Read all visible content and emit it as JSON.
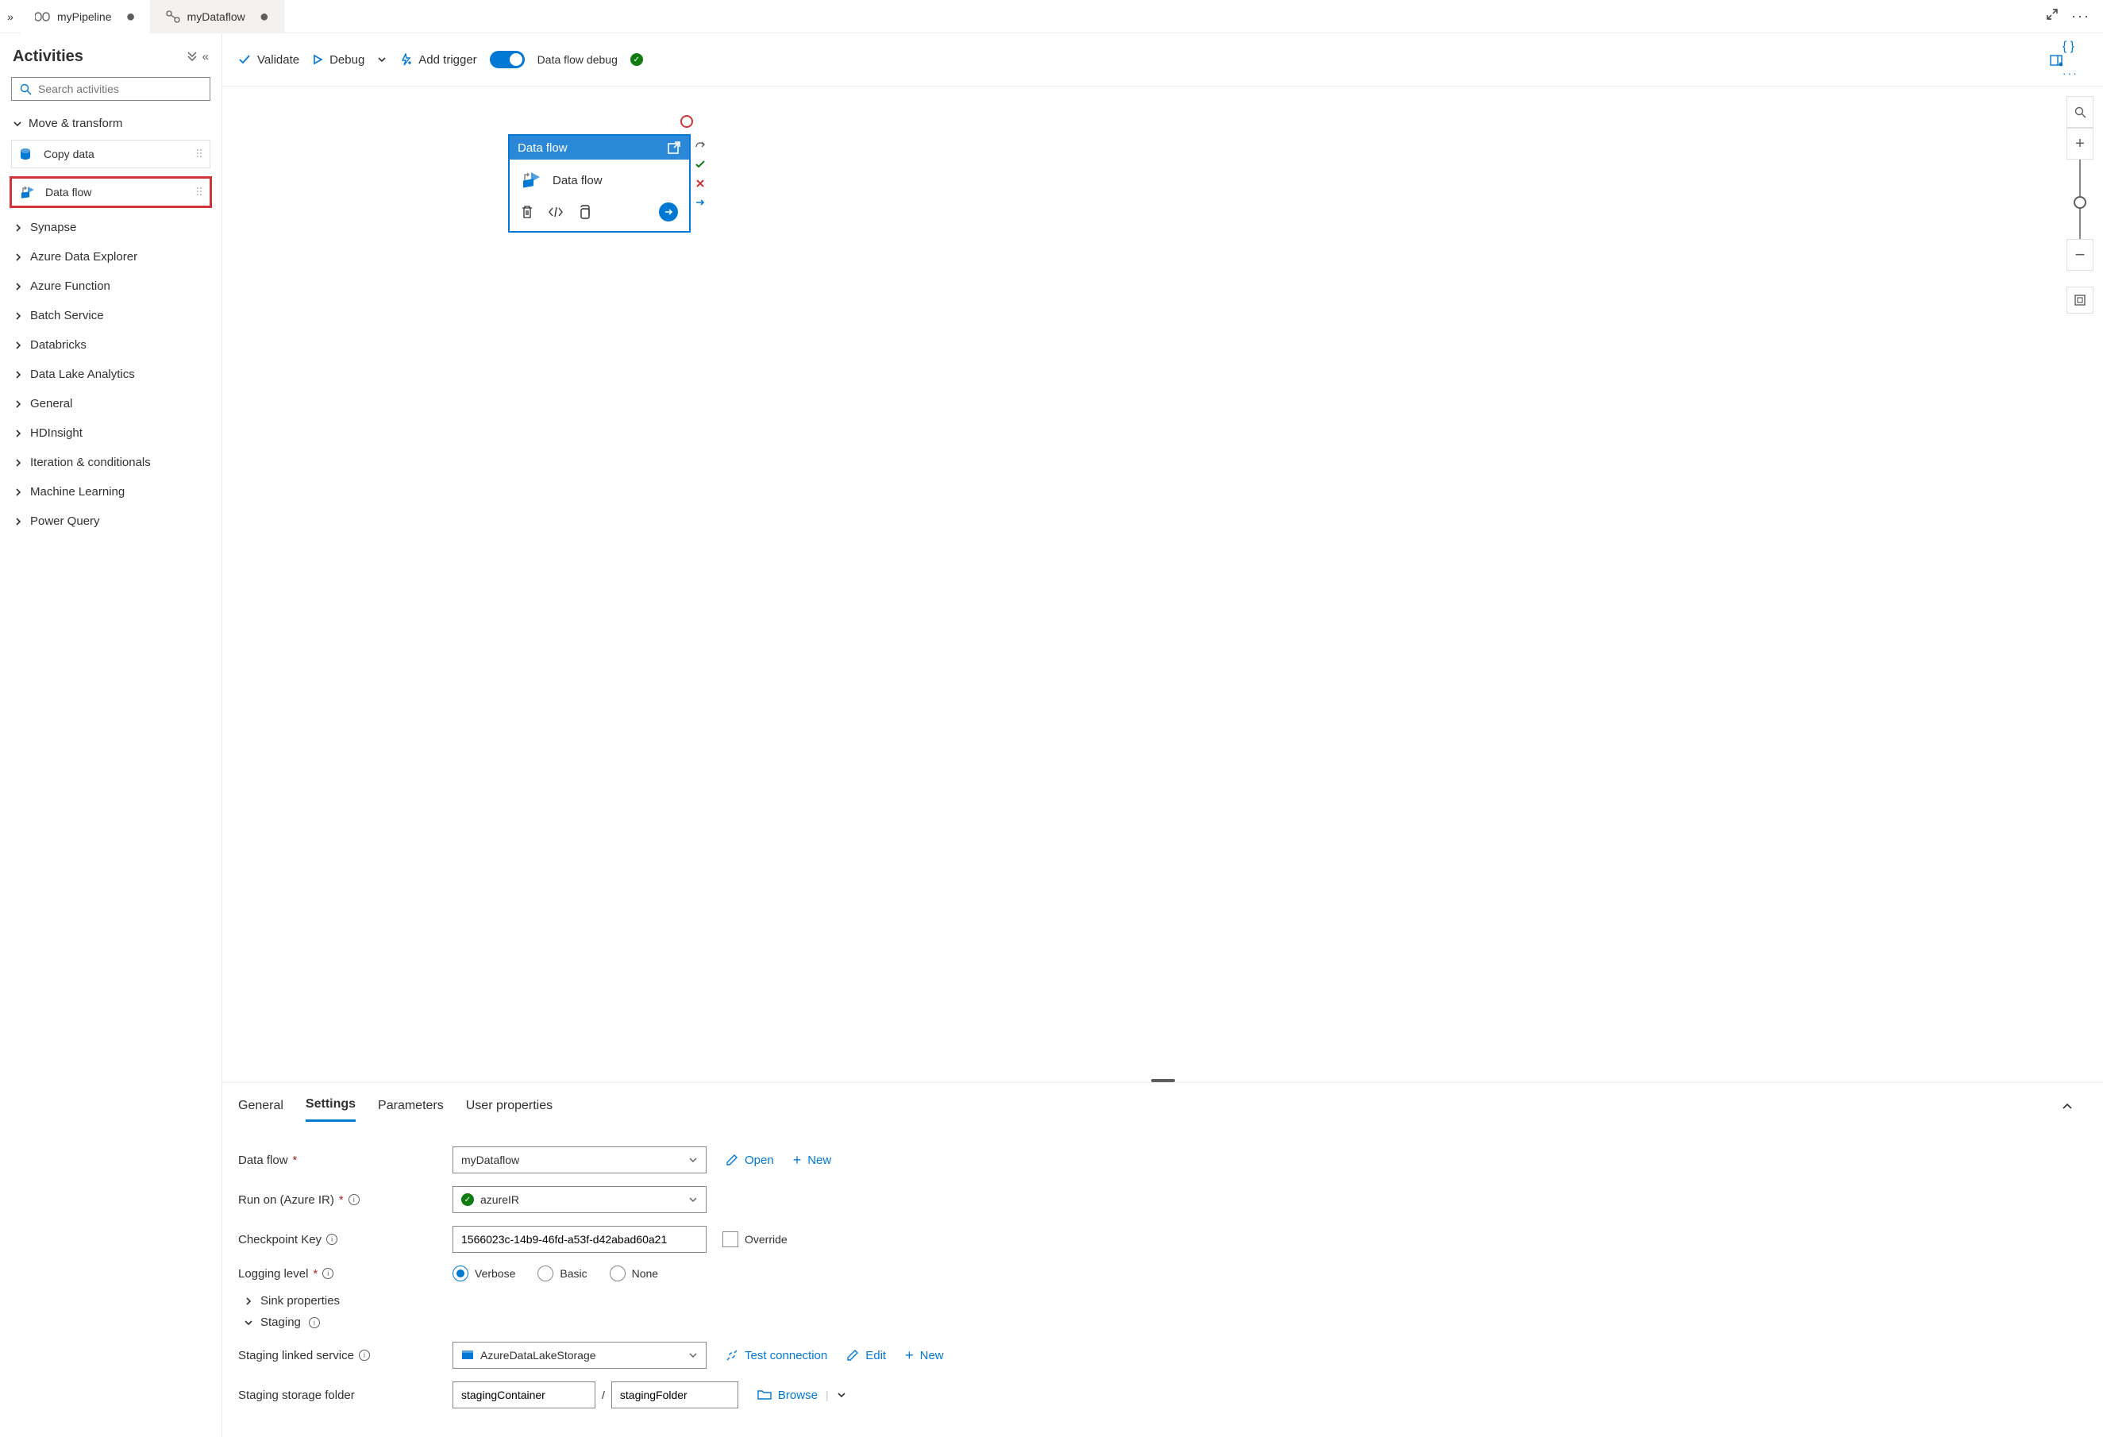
{
  "tabs": [
    {
      "label": "myPipeline",
      "dirty": true
    },
    {
      "label": "myDataflow",
      "dirty": true
    }
  ],
  "sidebar": {
    "title": "Activities",
    "search_placeholder": "Search activities",
    "group_move": "Move & transform",
    "items": {
      "copy": "Copy data",
      "dataflow": "Data flow"
    },
    "categories": [
      "Synapse",
      "Azure Data Explorer",
      "Azure Function",
      "Batch Service",
      "Databricks",
      "Data Lake Analytics",
      "General",
      "HDInsight",
      "Iteration & conditionals",
      "Machine Learning",
      "Power Query"
    ]
  },
  "toolbar": {
    "validate": "Validate",
    "debug": "Debug",
    "add_trigger": "Add trigger",
    "dataflow_debug": "Data flow debug"
  },
  "canvas": {
    "node_title": "Data flow",
    "node_name": "Data flow"
  },
  "props": {
    "tabs": {
      "general": "General",
      "settings": "Settings",
      "parameters": "Parameters",
      "user_properties": "User properties"
    },
    "dataflow_label": "Data flow",
    "dataflow_value": "myDataflow",
    "open": "Open",
    "new": "New",
    "runon_label": "Run on (Azure IR)",
    "runon_value": "azureIR",
    "checkpoint_label": "Checkpoint Key",
    "checkpoint_value": "1566023c-14b9-46fd-a53f-d42abad60a21",
    "override": "Override",
    "logging_label": "Logging level",
    "logging_options": {
      "verbose": "Verbose",
      "basic": "Basic",
      "none": "None"
    },
    "sink_properties": "Sink properties",
    "staging": "Staging",
    "staging_linked_label": "Staging linked service",
    "staging_linked_value": "AzureDataLakeStorage",
    "test_connection": "Test connection",
    "edit": "Edit",
    "staging_folder_label": "Staging storage folder",
    "staging_container": "stagingContainer",
    "staging_folder": "stagingFolder",
    "browse": "Browse"
  }
}
